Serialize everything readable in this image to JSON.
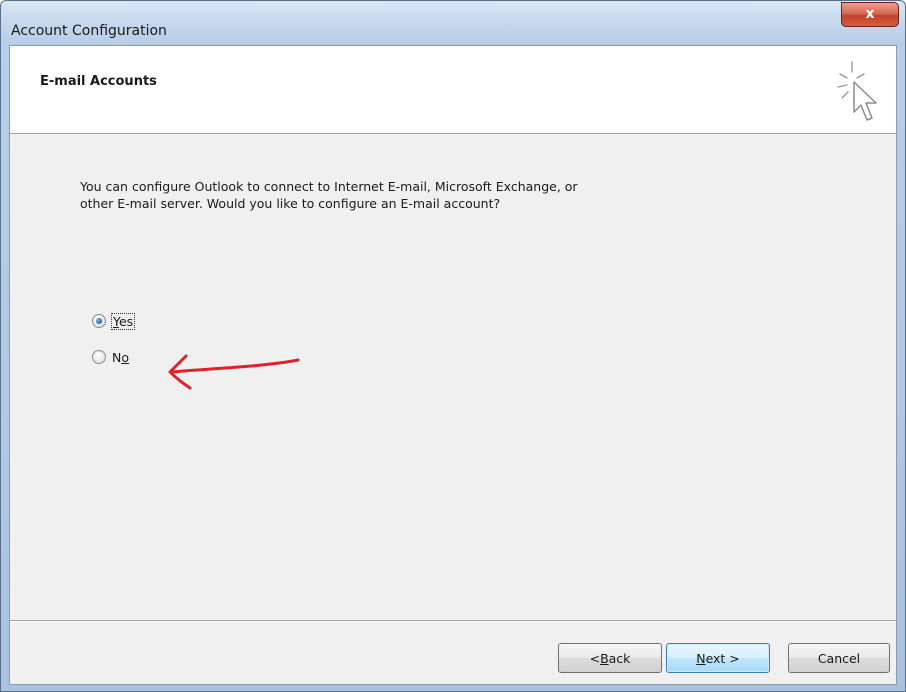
{
  "window": {
    "title": "Account Configuration",
    "close_label": "x"
  },
  "header": {
    "title": "E-mail Accounts"
  },
  "body": {
    "description_line1": "You can configure Outlook to connect to Internet E-mail, Microsoft Exchange, or",
    "description_line2": "other E-mail server. Would you like to configure an E-mail account?"
  },
  "options": {
    "yes": {
      "accel": "Y",
      "rest": "es",
      "checked": true
    },
    "no": {
      "pre": "N",
      "accel": "o",
      "checked": false
    }
  },
  "footer": {
    "back": {
      "pre": "< ",
      "accel": "B",
      "rest": "ack"
    },
    "next": {
      "accel": "N",
      "rest": "ext >"
    },
    "cancel": "Cancel"
  },
  "colors": {
    "annotation": "#e0222a",
    "default_button_border": "#3c7fb1",
    "close_button": "#c4412b"
  },
  "icons": [
    "close-icon",
    "wizard-cursor-icon",
    "red-arrow-annotation"
  ]
}
